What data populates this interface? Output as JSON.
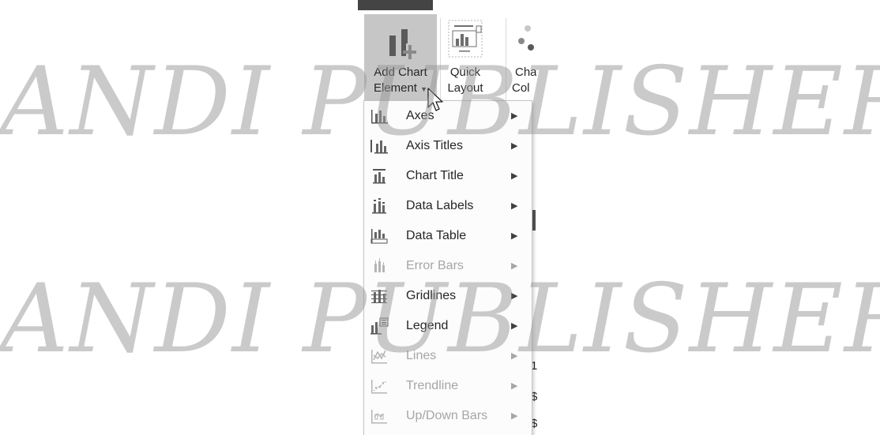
{
  "ribbon": {
    "add_chart": {
      "line1": "Add Chart",
      "line2": "Element",
      "icon": "add-chart-element-icon"
    },
    "quick_layout": {
      "line1": "Quick",
      "line2": "Layout",
      "icon": "quick-layout-icon"
    },
    "chart_colors": {
      "line1": "Cha",
      "line2": "Col",
      "icon": "chart-colors-icon"
    }
  },
  "menu": {
    "items": [
      {
        "label": "Axes",
        "enabled": true,
        "icon": "axes-icon"
      },
      {
        "label": "Axis Titles",
        "enabled": true,
        "icon": "axis-titles-icon"
      },
      {
        "label": "Chart Title",
        "enabled": true,
        "icon": "chart-title-icon"
      },
      {
        "label": "Data Labels",
        "enabled": true,
        "icon": "data-labels-icon"
      },
      {
        "label": "Data Table",
        "enabled": true,
        "icon": "data-table-icon"
      },
      {
        "label": "Error Bars",
        "enabled": false,
        "icon": "error-bars-icon"
      },
      {
        "label": "Gridlines",
        "enabled": true,
        "icon": "gridlines-icon"
      },
      {
        "label": "Legend",
        "enabled": true,
        "icon": "legend-icon"
      },
      {
        "label": "Lines",
        "enabled": false,
        "icon": "lines-icon"
      },
      {
        "label": "Trendline",
        "enabled": false,
        "icon": "trendline-icon"
      },
      {
        "label": "Up/Down Bars",
        "enabled": false,
        "icon": "up-down-bars-icon"
      }
    ]
  },
  "background_fragments": [
    "1",
    "$",
    "$"
  ],
  "watermark": {
    "line1": "ANDI PUBLISHER",
    "line2": "ANDI PUBLISHER"
  }
}
